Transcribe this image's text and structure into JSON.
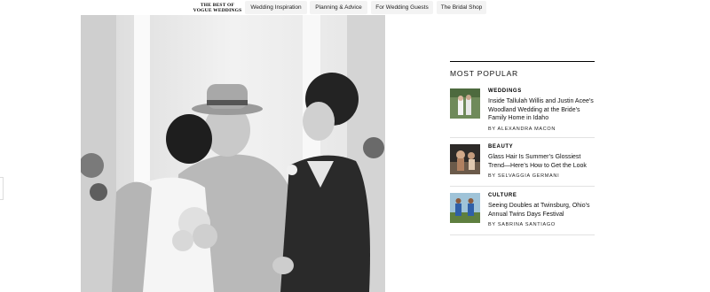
{
  "nav": {
    "brand_line1": "THE BEST OF",
    "brand_line2": "VOGUE WEDDINGS",
    "items": [
      {
        "label": "Wedding Inspiration"
      },
      {
        "label": "Planning & Advice"
      },
      {
        "label": "For Wedding Guests"
      },
      {
        "label": "The Bridal Shop"
      }
    ]
  },
  "sidebar": {
    "heading": "MOST POPULAR",
    "items": [
      {
        "category": "WEDDINGS",
        "title": "Inside Tallulah Willis and Justin Acee’s Woodland Wedding at the Bride’s Family Home in Idaho",
        "byline": "BY ALEXANDRA MACON"
      },
      {
        "category": "BEAUTY",
        "title": "Glass Hair Is Summer’s Glossiest Trend—Here’s How to Get the Look",
        "byline": "BY SELVAGGIA GERMANI"
      },
      {
        "category": "CULTURE",
        "title": "Seeing Doubles at Twinsburg, Ohio’s Annual Twins Days Festival",
        "byline": "BY SABRINA SANTIAGO"
      }
    ]
  }
}
